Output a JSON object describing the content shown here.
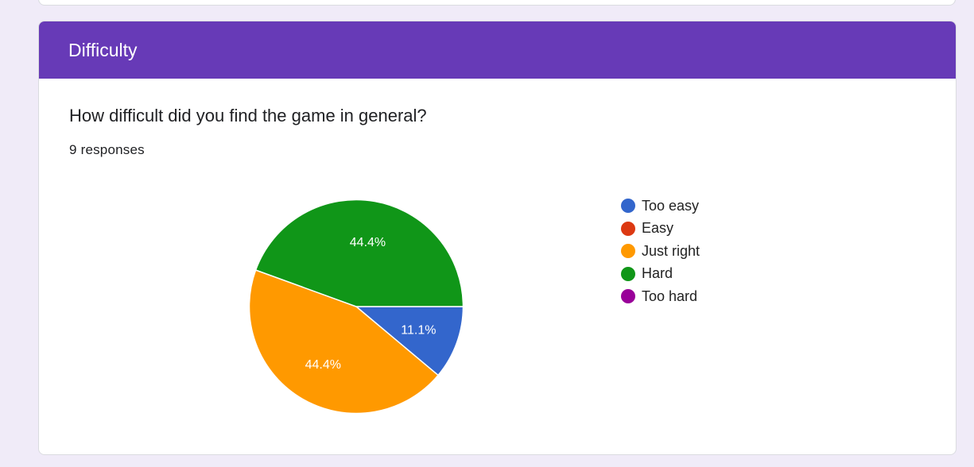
{
  "section": {
    "title": "Difficulty"
  },
  "question": {
    "title": "How difficult did you find the game in general?",
    "responses": "9 responses"
  },
  "colors": {
    "header": "#673ab7",
    "background": "#f0ebf8"
  },
  "chart_data": {
    "type": "pie",
    "categories": [
      "Too easy",
      "Easy",
      "Just right",
      "Hard",
      "Too hard"
    ],
    "values": [
      11.1,
      0,
      44.4,
      44.4,
      0
    ],
    "counts": [
      1,
      0,
      4,
      4,
      0
    ],
    "labels": [
      "11.1%",
      "",
      "44.4%",
      "44.4%",
      ""
    ],
    "colors": [
      "#3366cc",
      "#dc3912",
      "#ff9900",
      "#109618",
      "#990099"
    ],
    "legend_position": "right"
  }
}
